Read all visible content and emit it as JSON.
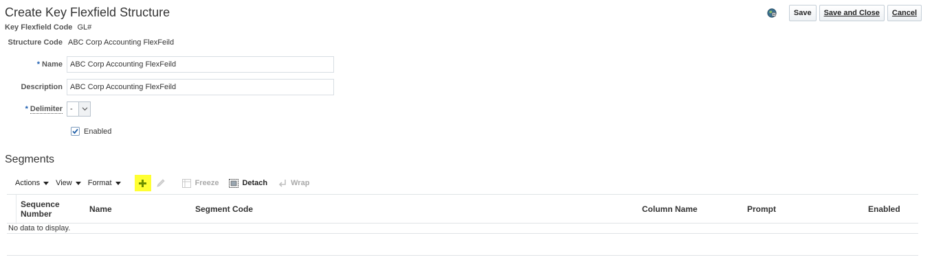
{
  "header": {
    "title": "Create Key Flexfield Structure",
    "kff_label": "Key Flexfield Code",
    "kff_value": "GL#"
  },
  "actions": {
    "save": "Save",
    "save_and_close": "Save and Close",
    "cancel": "Cancel"
  },
  "form": {
    "structure_code_label": "Structure Code",
    "structure_code_value": "ABC Corp Accounting FlexFeild",
    "name_required": "*",
    "name_label": "Name",
    "name_value": "ABC Corp Accounting FlexFeild",
    "description_label": "Description",
    "description_value": "ABC Corp Accounting FlexFeild",
    "delimiter_required": "*",
    "delimiter_label": "Delimiter",
    "delimiter_value": "-",
    "enabled_label": "Enabled",
    "enabled_checked": true
  },
  "segments": {
    "title": "Segments",
    "menus": {
      "actions": "Actions",
      "view": "View",
      "format": "Format"
    },
    "toolbar": {
      "freeze": "Freeze",
      "detach": "Detach",
      "wrap": "Wrap"
    },
    "columns": {
      "sequence_number_line1": "Sequence",
      "sequence_number_line2": "Number",
      "name": "Name",
      "segment_code": "Segment Code",
      "column_name": "Column Name",
      "prompt": "Prompt",
      "enabled": "Enabled"
    },
    "empty_message": "No data to display."
  },
  "colors": {
    "highlight": "#ffff33",
    "required_star": "#1a5cb0",
    "add_icon": "#6b8e00"
  }
}
